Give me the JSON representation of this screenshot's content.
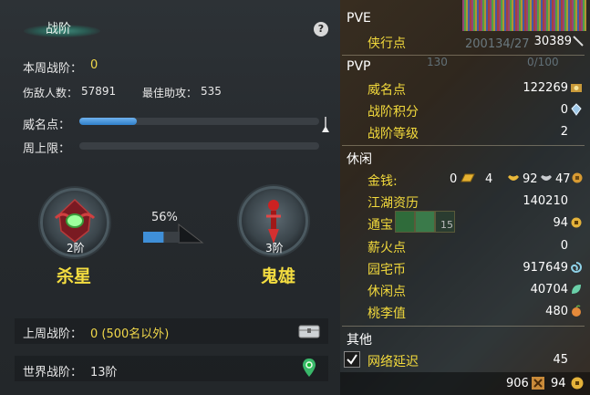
{
  "panel": {
    "title": "战阶",
    "help_label": "?",
    "weekly_label": "本周战阶：",
    "weekly_value": "0",
    "kills_label": "伤敌人数：",
    "kills_value": "57891",
    "assist_label": "最佳助攻：",
    "assist_value": "535",
    "fame_label": "威名点：",
    "fame_progress": 0.24,
    "cap_label": "周上限：",
    "cap_progress": 0.0,
    "left_rank": {
      "level": "2阶",
      "name": "杀星"
    },
    "progress_pct": "56%",
    "progress_value": 0.56,
    "right_rank": {
      "level": "3阶",
      "name": "鬼雄"
    },
    "last_week_label": "上周战阶：",
    "last_week_value": "0 (500名以外)",
    "world_label": "世界战阶：",
    "world_value": "13阶"
  },
  "stats": {
    "pve_header": "PVE",
    "pve_rows": [
      {
        "label": "侠行点",
        "value": "30389"
      }
    ],
    "pvp_header": "PVP",
    "pvp_rows": [
      {
        "label": "威名点",
        "value": "122269"
      },
      {
        "label": "战阶积分",
        "value": "0"
      },
      {
        "label": "战阶等级",
        "value": "2"
      }
    ],
    "leisure_header": "休闲",
    "money_label": "金钱:",
    "money": {
      "gold_bar": "0",
      "gold": "4",
      "silver": "92",
      "copper": "47"
    },
    "jianghu_label": "江湖资历",
    "jianghu_value": "140210",
    "tongbao_label": "通宝",
    "tongbao_slot": "15",
    "tongbao_value": "94",
    "xinhuo_label": "薪火点",
    "xinhuo_value": "0",
    "yuanzhai_label": "园宅币",
    "yuanzhai_value": "917649",
    "xiuxian_label": "休闲点",
    "xiuxian_value": "40704",
    "taoli_label": "桃李值",
    "taoli_value": "480",
    "other_header": "其他",
    "latency_label": "网络延迟",
    "latency_value": "45",
    "footer_left": "906",
    "footer_right": "94",
    "bg_number_1": "200134/27",
    "bg_number_2": "130",
    "bg_number_3": "0/100"
  },
  "colors": {
    "accent": "#f3da3c",
    "bar_blue": "#3f8fd8",
    "panel_bg": "#262a2e"
  }
}
